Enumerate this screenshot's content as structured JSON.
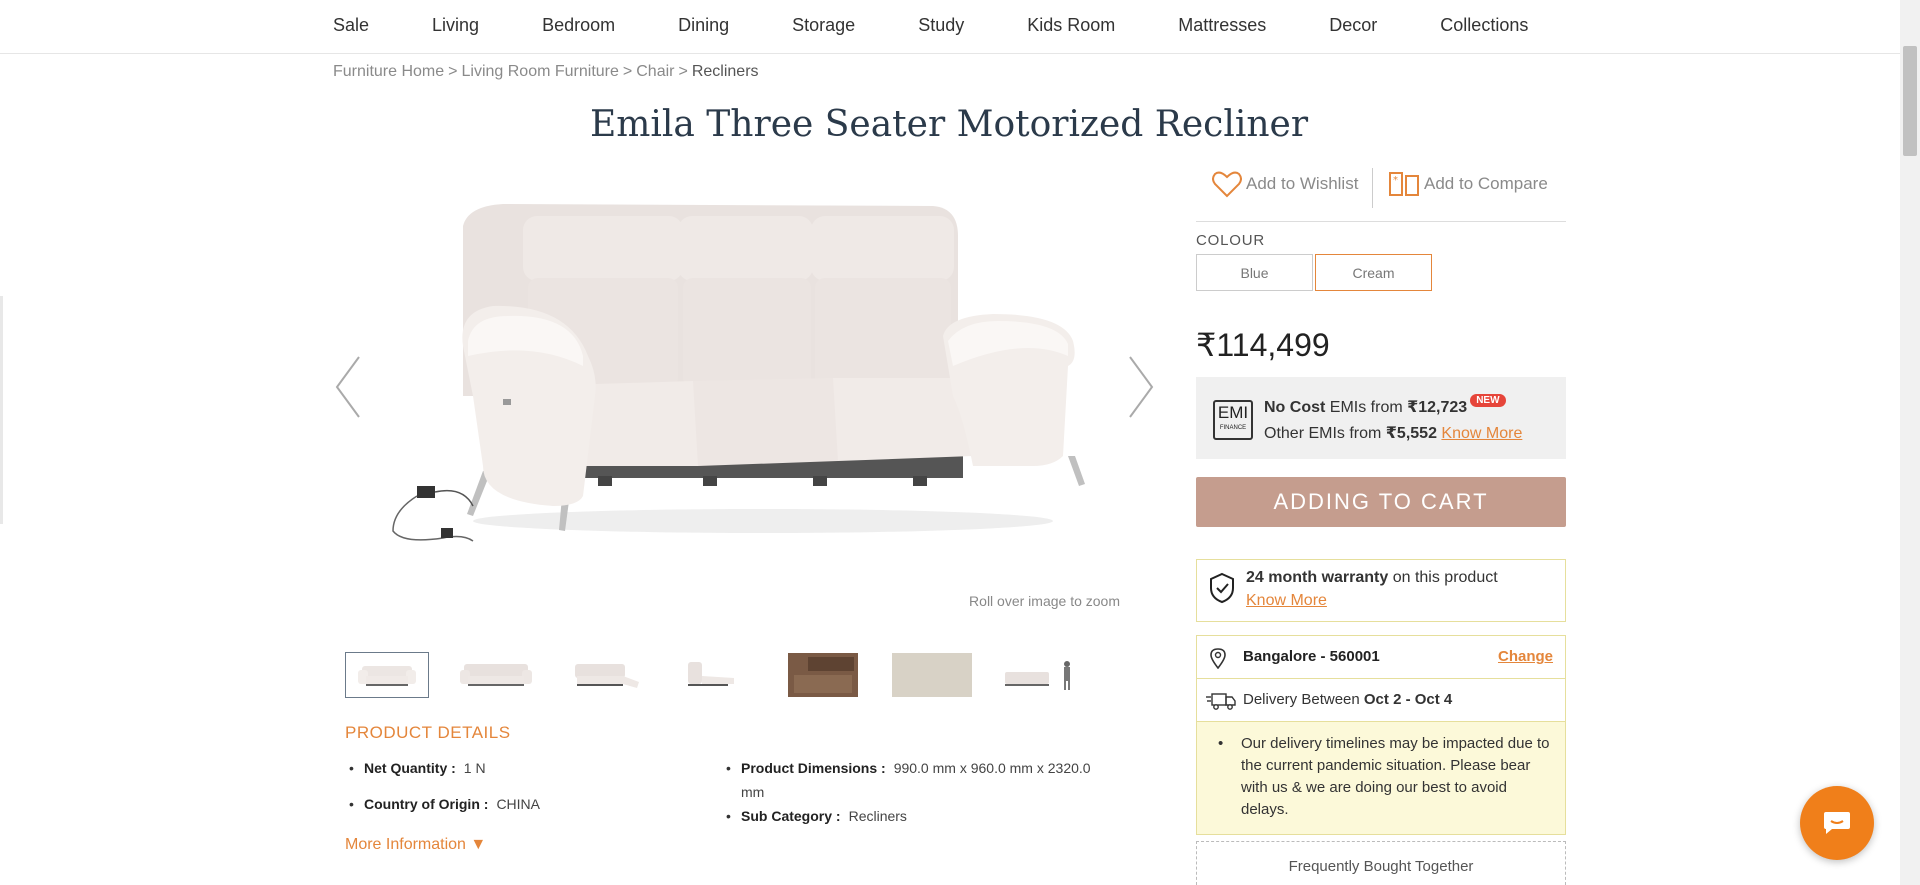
{
  "nav": {
    "items": [
      "Sale",
      "Living",
      "Bedroom",
      "Dining",
      "Storage",
      "Study",
      "Kids Room",
      "Mattresses",
      "Decor",
      "Collections"
    ]
  },
  "breadcrumb": {
    "items": [
      "Furniture Home",
      "Living Room Furniture",
      "Chair"
    ],
    "separator": ">",
    "current": "Recliners"
  },
  "product": {
    "title": "Emila Three Seater Motorized Recliner",
    "zoom_hint": "Roll over image to zoom"
  },
  "actions": {
    "wishlist": "Add to Wishlist",
    "compare": "Add to Compare"
  },
  "colour": {
    "label": "COLOUR",
    "options": [
      "Blue",
      "Cream"
    ],
    "selected": "Cream",
    "accent": "#e4863b"
  },
  "price": "₹114,499",
  "emi": {
    "logo_text": "EMI",
    "logo_sub": "FINANCE",
    "no_cost_label": "No Cost",
    "line1_mid": " EMIs from ",
    "line1_amount": "₹12,723",
    "new_badge": "NEW",
    "line2_prefix": "Other EMIs from ",
    "line2_amount": "₹5,552",
    "know_more": "Know More"
  },
  "cart": {
    "label": "ADDING TO CART",
    "color": "#c59d8e"
  },
  "warranty": {
    "bold": "24 month warranty",
    "rest": " on this product",
    "know_more": "Know More"
  },
  "delivery": {
    "location": "Bangalore - 560001",
    "change": "Change",
    "prefix": "Delivery Between ",
    "dates": "Oct 2 - Oct 4",
    "notice": "Our delivery timelines may be impacted due to the current pandemic situation. Please bear with us & we are doing our best to avoid delays."
  },
  "fbt": "Frequently Bought Together",
  "details": {
    "heading": "PRODUCT DETAILS",
    "left": [
      {
        "label": "Net Quantity :",
        "value": "1 N"
      },
      {
        "label": "Country of Origin :",
        "value": "CHINA"
      }
    ],
    "right": [
      {
        "label": "Product Dimensions :",
        "value": "990.0 mm x 960.0 mm x 2320.0 mm"
      },
      {
        "label": "Sub Category :",
        "value": "Recliners"
      }
    ],
    "more": "More Information ▼"
  }
}
